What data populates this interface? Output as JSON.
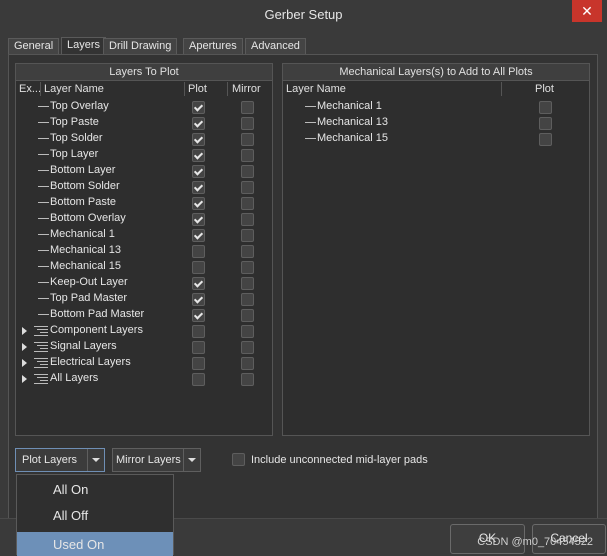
{
  "window": {
    "title": "Gerber Setup",
    "close_glyph": "✕"
  },
  "tabs": [
    "General",
    "Layers",
    "Drill Drawing",
    "Apertures",
    "Advanced"
  ],
  "active_tab": "Layers",
  "left_panel": {
    "title": "Layers To Plot",
    "columns": [
      "Ex...",
      "Layer Name",
      "Plot",
      "Mirror"
    ],
    "rows": [
      {
        "name": "Top Overlay",
        "kind": "layer",
        "plot": true,
        "mirror": false
      },
      {
        "name": "Top Paste",
        "kind": "layer",
        "plot": true,
        "mirror": false
      },
      {
        "name": "Top Solder",
        "kind": "layer",
        "plot": true,
        "mirror": false
      },
      {
        "name": "Top Layer",
        "kind": "layer",
        "plot": true,
        "mirror": false
      },
      {
        "name": "Bottom Layer",
        "kind": "layer",
        "plot": true,
        "mirror": false
      },
      {
        "name": "Bottom Solder",
        "kind": "layer",
        "plot": true,
        "mirror": false
      },
      {
        "name": "Bottom Paste",
        "kind": "layer",
        "plot": true,
        "mirror": false
      },
      {
        "name": "Bottom Overlay",
        "kind": "layer",
        "plot": true,
        "mirror": false
      },
      {
        "name": "Mechanical 1",
        "kind": "layer",
        "plot": true,
        "mirror": false
      },
      {
        "name": "Mechanical 13",
        "kind": "layer",
        "plot": false,
        "mirror": false
      },
      {
        "name": "Mechanical 15",
        "kind": "layer",
        "plot": false,
        "mirror": false
      },
      {
        "name": "Keep-Out Layer",
        "kind": "layer",
        "plot": true,
        "mirror": false
      },
      {
        "name": "Top Pad Master",
        "kind": "layer",
        "plot": true,
        "mirror": false
      },
      {
        "name": "Bottom Pad Master",
        "kind": "layer",
        "plot": true,
        "mirror": false
      },
      {
        "name": "Component Layers",
        "kind": "group",
        "plot": false,
        "mirror": false
      },
      {
        "name": "Signal Layers",
        "kind": "group",
        "plot": false,
        "mirror": false
      },
      {
        "name": "Electrical Layers",
        "kind": "group",
        "plot": false,
        "mirror": false
      },
      {
        "name": "All Layers",
        "kind": "group",
        "plot": false,
        "mirror": false
      }
    ]
  },
  "right_panel": {
    "title": "Mechanical Layers(s) to Add to All Plots",
    "columns": [
      "Layer Name",
      "Plot"
    ],
    "rows": [
      {
        "name": "Mechanical 1",
        "plot": false
      },
      {
        "name": "Mechanical 13",
        "plot": false
      },
      {
        "name": "Mechanical 15",
        "plot": false
      }
    ]
  },
  "controls": {
    "plot_layers": "Plot Layers",
    "mirror_layers": "Mirror Layers",
    "include_unconnected": "Include unconnected mid-layer pads",
    "include_unconnected_checked": false
  },
  "plot_menu": {
    "items": [
      "All On",
      "All Off",
      "Used On"
    ],
    "highlighted": "Used On"
  },
  "buttons": {
    "ok": "OK",
    "cancel": "Cancel"
  },
  "watermark": "CSDN @m0_70454522"
}
